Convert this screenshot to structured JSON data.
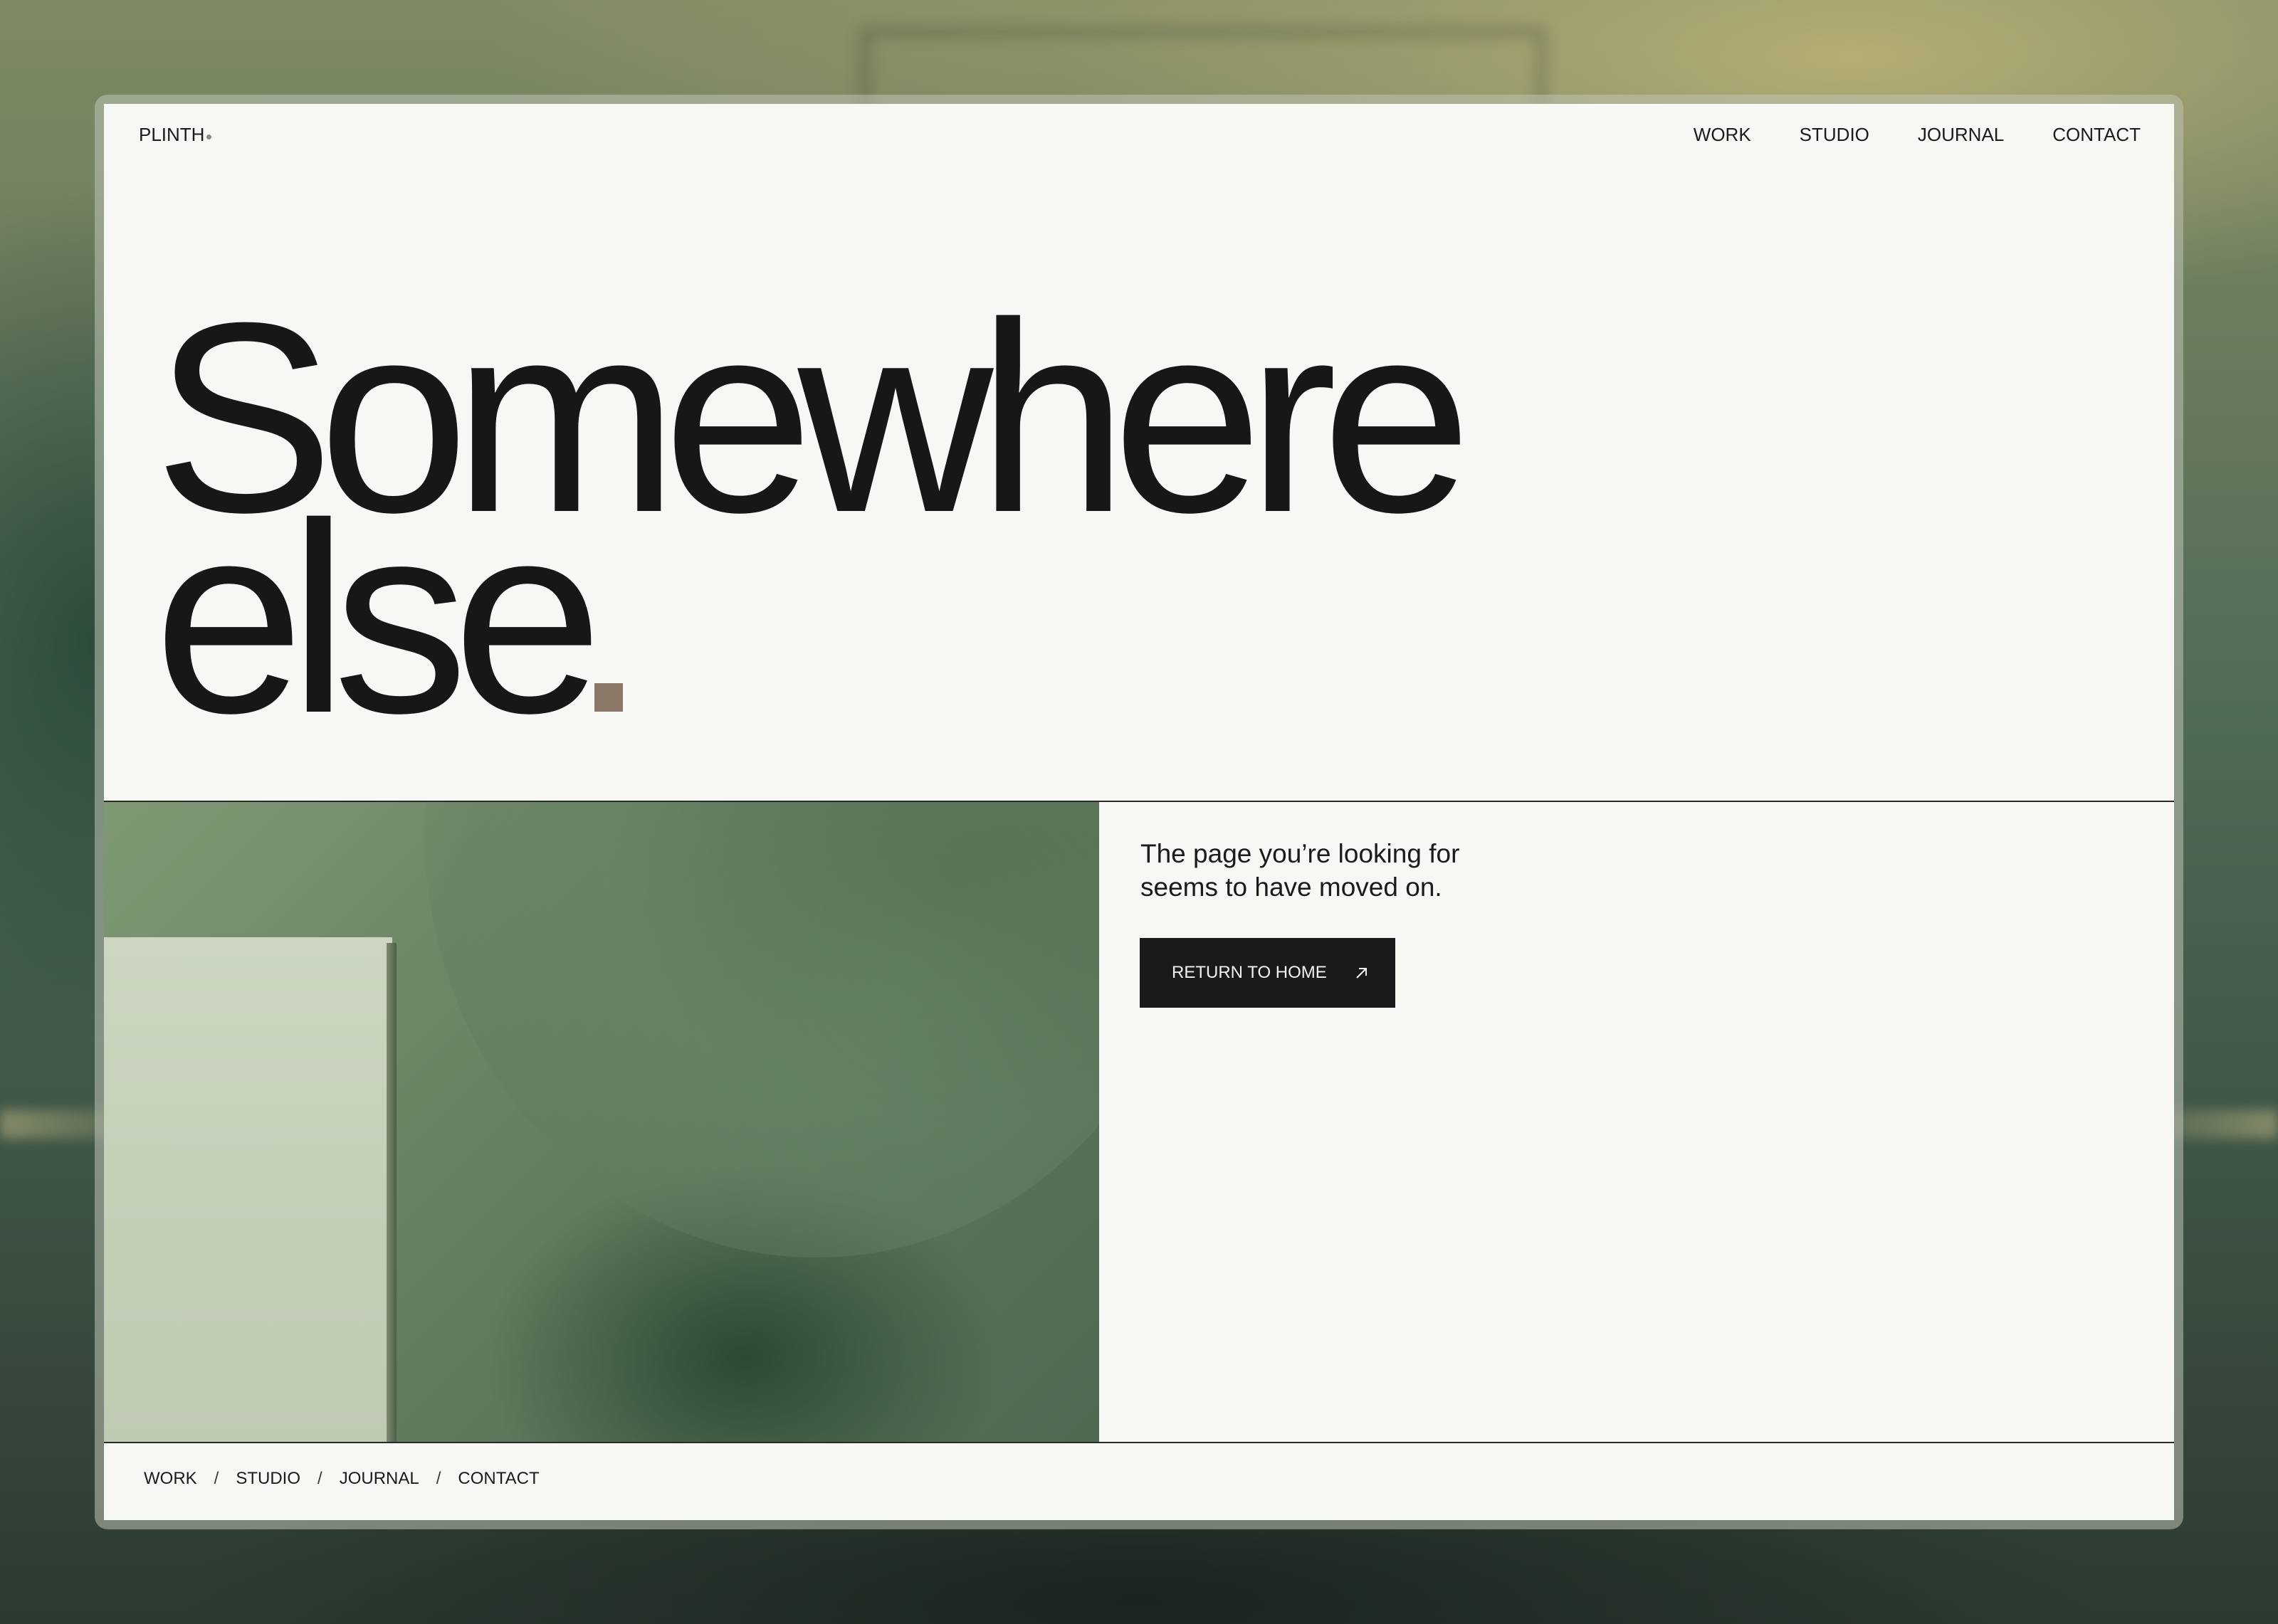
{
  "brand": {
    "logo": "PLINTH"
  },
  "nav": {
    "items": [
      "WORK",
      "STUDIO",
      "JOURNAL",
      "CONTACT"
    ]
  },
  "hero": {
    "line1": "Somewhere",
    "line2": "else"
  },
  "message": {
    "line1": "The page you’re looking for",
    "line2": "seems to have moved on."
  },
  "cta": {
    "label": "RETURN TO HOME",
    "icon": "arrow-up-right-icon"
  },
  "footer": {
    "items": [
      "WORK",
      "STUDIO",
      "JOURNAL",
      "CONTACT"
    ],
    "separator": "/"
  },
  "colors": {
    "page_background": "#f7f7f4",
    "text": "#1b1b1a",
    "accent_period": "#8b7866",
    "button_background": "#1a1a1a",
    "button_text": "#f2f2ee"
  }
}
